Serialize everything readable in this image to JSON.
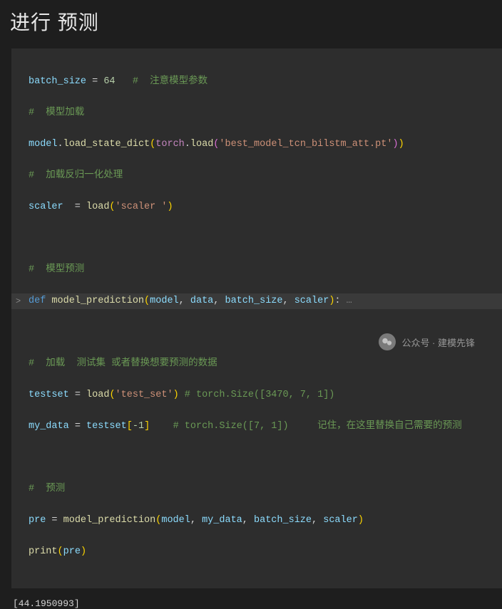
{
  "title": "进行 预测",
  "code": {
    "l1_var": "batch_size",
    "l1_eq": " = ",
    "l1_num": "64",
    "l1_com": "   #  注意模型参数",
    "l2_com": "#  模型加载",
    "l3_var": "model",
    "l3_dot": ".",
    "l3_fn": "load_state_dict",
    "l3_p1": "(",
    "l3_mod": "torch",
    "l3_dot2": ".",
    "l3_fn2": "load",
    "l3_p2": "(",
    "l3_str": "'best_model_tcn_bilstm_att.pt'",
    "l3_p3": ")",
    "l3_p4": ")",
    "l4_com": "#  加载反归一化处理",
    "l5_var": "scaler",
    "l5_eq": "  = ",
    "l5_fn": "load",
    "l5_p1": "(",
    "l5_str": "'scaler '",
    "l5_p2": ")",
    "l7_com": "#  模型预测",
    "l8_kw": "def",
    "l8_fn": " model_prediction",
    "l8_p1": "(",
    "l8_a1": "model",
    "l8_c1": ", ",
    "l8_a2": "data",
    "l8_c2": ", ",
    "l8_a3": "batch_size",
    "l8_c3": ", ",
    "l8_a4": "scaler",
    "l8_p2": ")",
    "l8_col": ":",
    "l8_ell": " …",
    "l10_com": "#  加载  测试集 或者替换想要预测的数据",
    "l11_var": "testset",
    "l11_eq": " = ",
    "l11_fn": "load",
    "l11_p1": "(",
    "l11_str": "'test_set'",
    "l11_p2": ")",
    "l11_com": " # torch.Size([3470, 7, 1])",
    "l12_var": "my_data",
    "l12_eq": " = ",
    "l12_var2": "testset",
    "l12_b1": "[",
    "l12_idx": "-1",
    "l12_b2": "]",
    "l12_com": "    # torch.Size([7, 1])     记住，在这里替换自己需要的预测",
    "l14_com": "#  预测",
    "l15_var": "pre",
    "l15_eq": " = ",
    "l15_fn": "model_prediction",
    "l15_p1": "(",
    "l15_a1": "model",
    "l15_c1": ", ",
    "l15_a2": "my_data",
    "l15_c2": ", ",
    "l15_a3": "batch_size",
    "l15_c3": ", ",
    "l15_a4": "scaler",
    "l15_p2": ")",
    "l16_fn": "print",
    "l16_p1": "(",
    "l16_var": "pre",
    "l16_p2": ")",
    "gutter": ">"
  },
  "output": "[44.1950993]",
  "watermark": "公众号 · 建模先锋"
}
